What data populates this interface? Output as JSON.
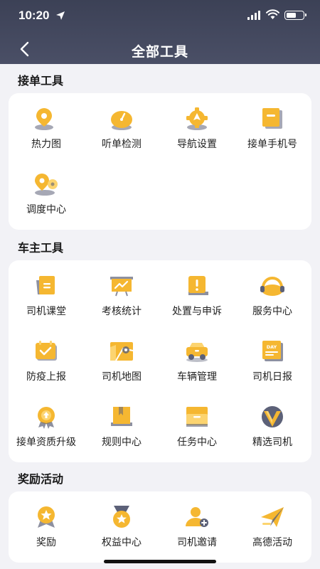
{
  "status_bar": {
    "time": "10:20"
  },
  "header": {
    "title": "全部工具"
  },
  "colors": {
    "header_bg": "#434860",
    "icon_main": "#f5b731",
    "icon_light": "#fcd470",
    "icon_shadow": "#5c6178",
    "page_bg": "#f2f2f6"
  },
  "sections": [
    {
      "title": "接单工具",
      "tools": [
        {
          "label": "热力图",
          "icon": "heatmap-pin-icon"
        },
        {
          "label": "听单检测",
          "icon": "gauge-icon"
        },
        {
          "label": "导航设置",
          "icon": "navigation-gear-icon"
        },
        {
          "label": "接单手机号",
          "icon": "phone-card-icon"
        },
        {
          "label": "调度中心",
          "icon": "dispatch-pin-icon"
        }
      ]
    },
    {
      "title": "车主工具",
      "tools": [
        {
          "label": "司机课堂",
          "icon": "classroom-book-icon"
        },
        {
          "label": "考核统计",
          "icon": "statistics-board-icon"
        },
        {
          "label": "处置与申诉",
          "icon": "appeal-alert-icon"
        },
        {
          "label": "服务中心",
          "icon": "headset-icon"
        },
        {
          "label": "防疫上报",
          "icon": "epidemic-check-icon"
        },
        {
          "label": "司机地图",
          "icon": "driver-map-icon"
        },
        {
          "label": "车辆管理",
          "icon": "car-icon"
        },
        {
          "label": "司机日报",
          "icon": "daily-report-icon"
        },
        {
          "label": "接单资质升级",
          "icon": "upgrade-badge-icon"
        },
        {
          "label": "规则中心",
          "icon": "rules-book-icon"
        },
        {
          "label": "任务中心",
          "icon": "task-folder-icon"
        },
        {
          "label": "精选司机",
          "icon": "featured-driver-icon"
        }
      ]
    },
    {
      "title": "奖励活动",
      "tools": [
        {
          "label": "奖励",
          "icon": "reward-star-icon"
        },
        {
          "label": "权益中心",
          "icon": "benefits-medal-icon"
        },
        {
          "label": "司机邀请",
          "icon": "invite-driver-icon"
        },
        {
          "label": "高德活动",
          "icon": "activity-plane-icon"
        }
      ]
    }
  ]
}
